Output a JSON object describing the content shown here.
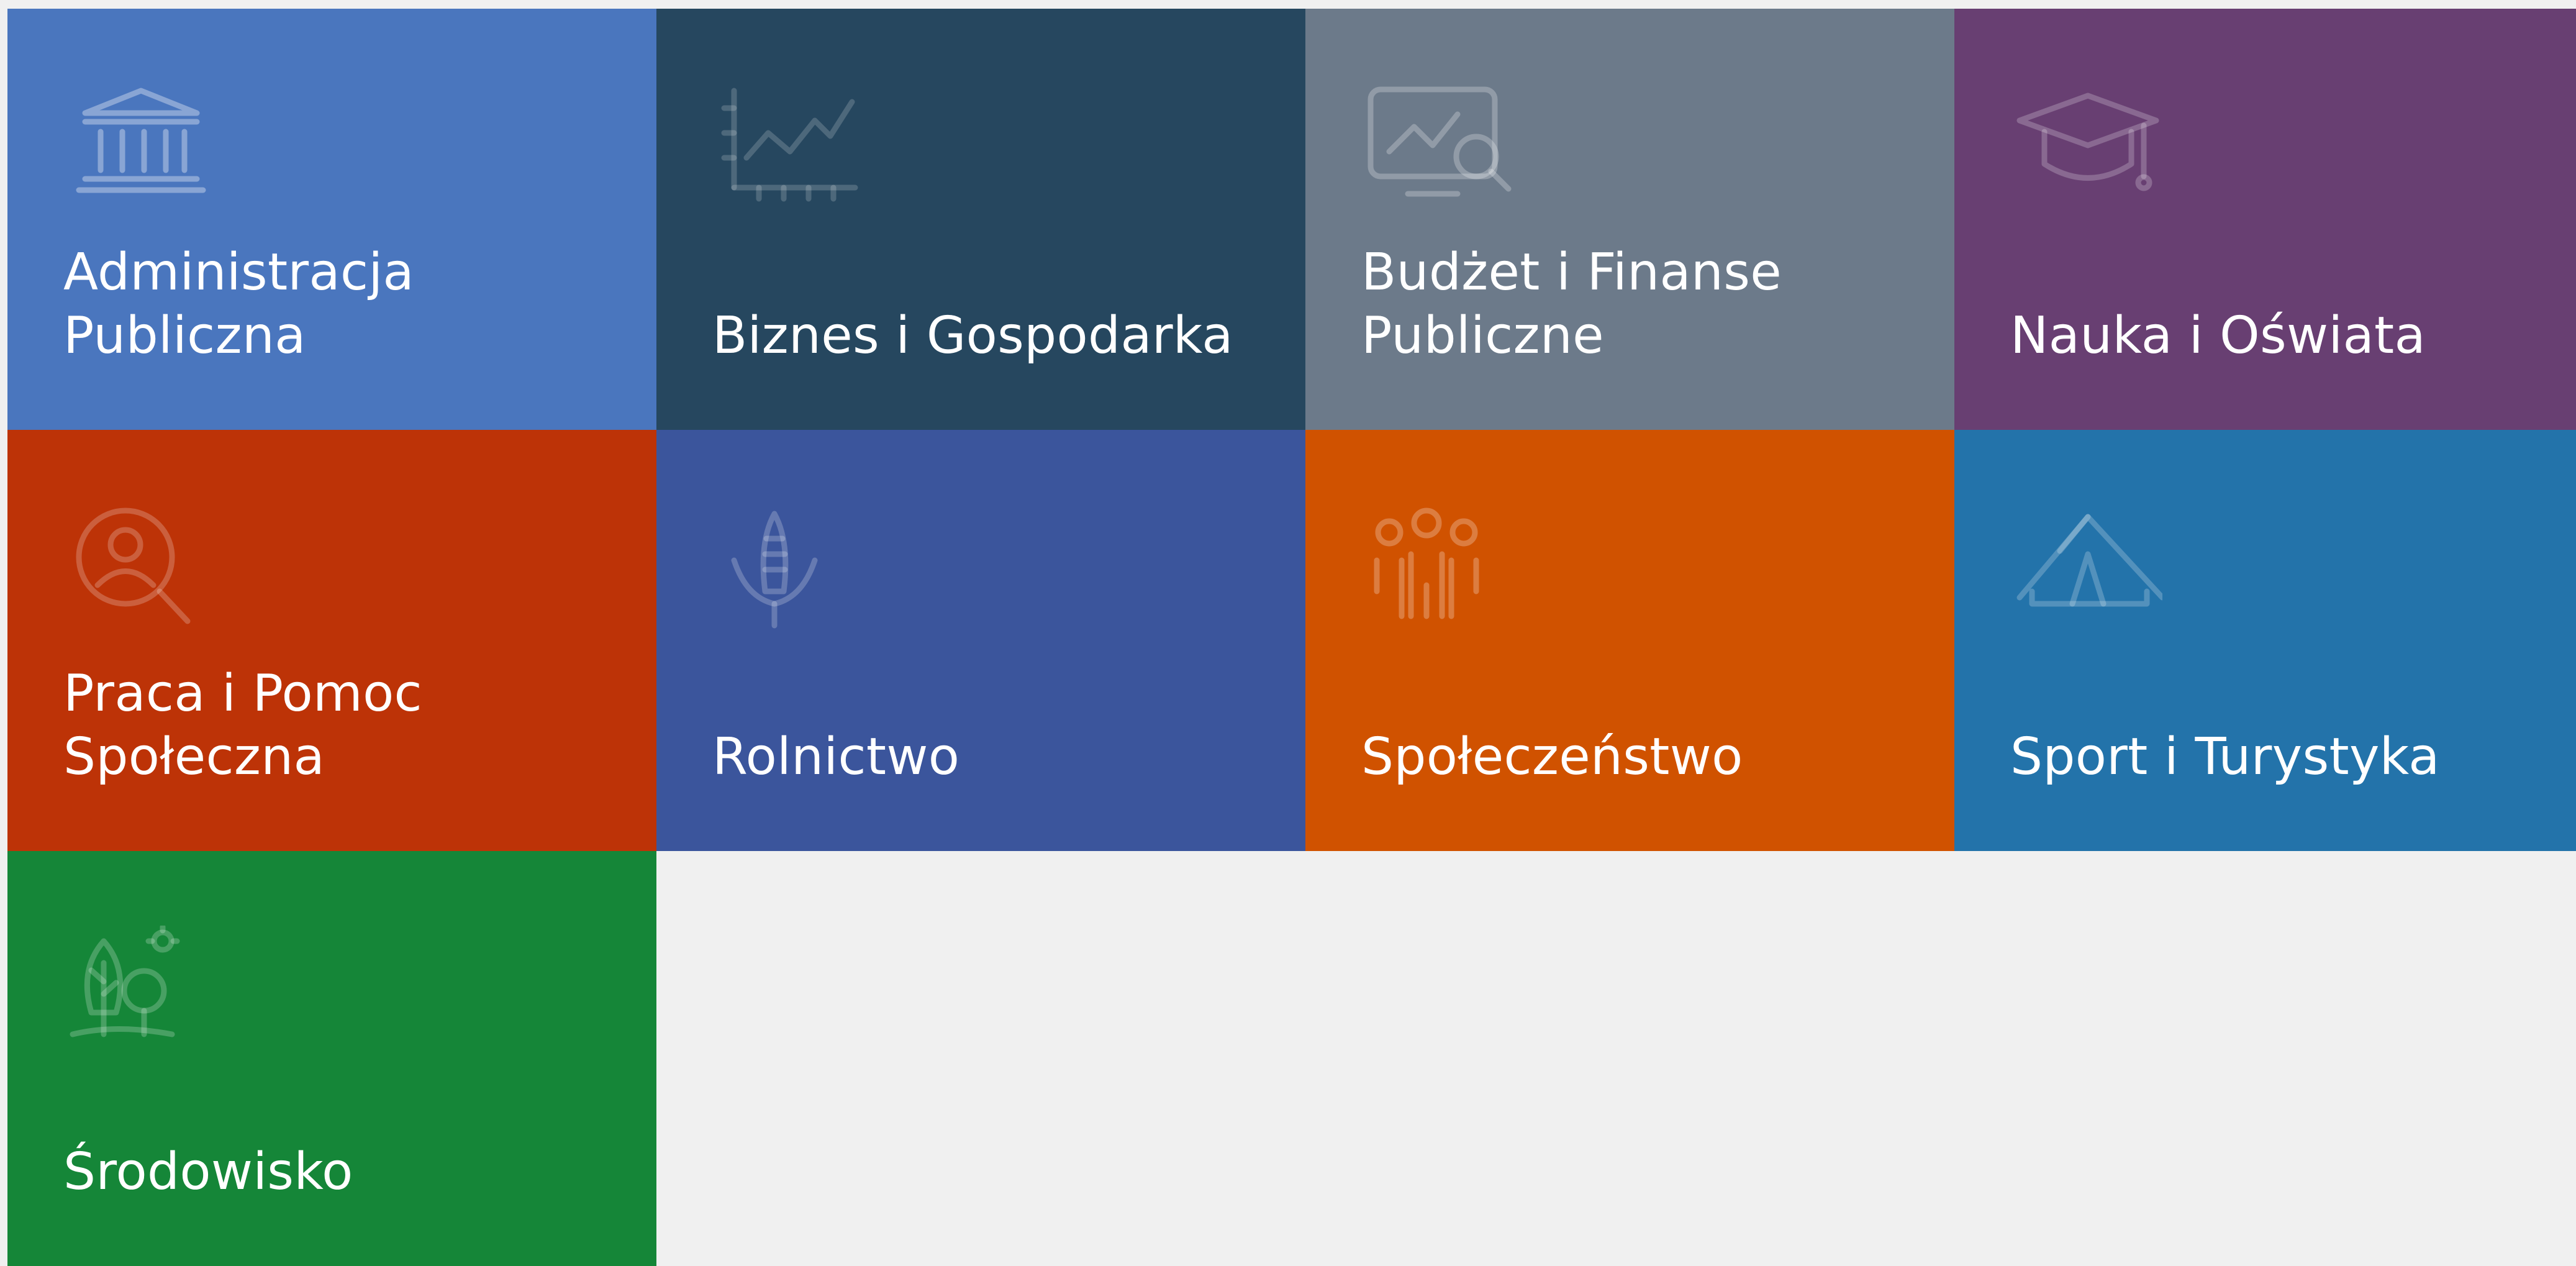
{
  "tiles": [
    {
      "label": "Administracja\nPubliczna",
      "color": "#4a76be",
      "icon": "government-building-icon"
    },
    {
      "label": "Biznes i Gospodarka",
      "color": "#26475f",
      "icon": "line-chart-icon"
    },
    {
      "label": "Budżet i Finanse\nPubliczne",
      "color": "#6c7a8a",
      "icon": "monitor-chart-search-icon"
    },
    {
      "label": "Nauka i Oświata",
      "color": "#683f72",
      "icon": "graduation-cap-icon"
    },
    {
      "label": "Praca i Pomoc\nSpołeczna",
      "color": "#bd3307",
      "icon": "person-search-icon"
    },
    {
      "label": "Rolnictwo",
      "color": "#3b559c",
      "icon": "corn-icon"
    },
    {
      "label": "Społeczeństwo",
      "color": "#d05200",
      "icon": "people-group-icon"
    },
    {
      "label": "Sport i Turystyka",
      "color": "#2373aa",
      "icon": "tent-icon"
    },
    {
      "label": "Środowisko",
      "color": "#158638",
      "icon": "trees-sun-icon"
    }
  ]
}
